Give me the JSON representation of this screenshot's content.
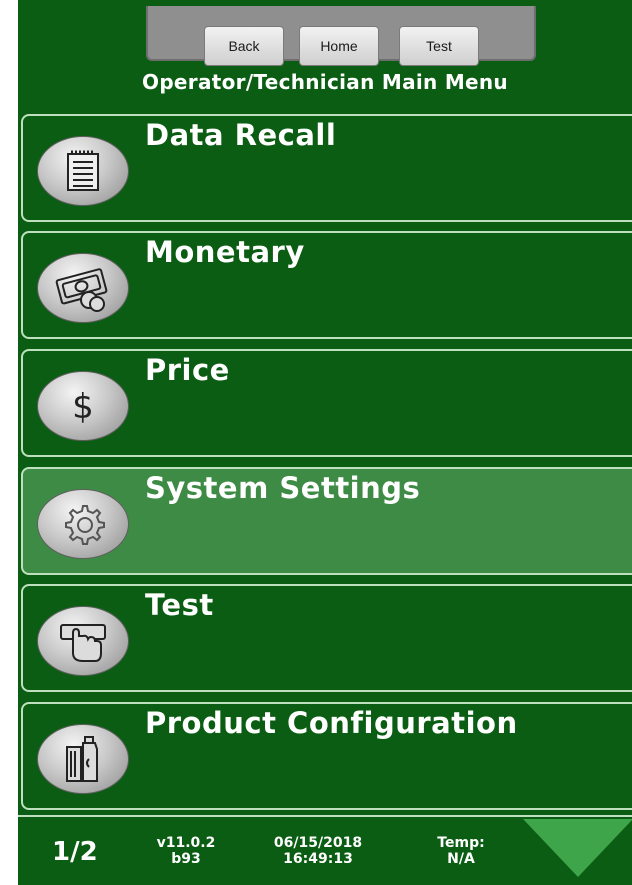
{
  "top_buttons": [
    {
      "label": "Back"
    },
    {
      "label": "Home"
    },
    {
      "label": "Test"
    }
  ],
  "title": "Operator/Technician Main Menu",
  "menu_items": [
    {
      "label": "Data Recall",
      "icon": "notepad-icon"
    },
    {
      "label": "Monetary",
      "icon": "money-icon"
    },
    {
      "label": "Price",
      "icon": "dollar-icon"
    },
    {
      "label": "System Settings",
      "icon": "gear-icon",
      "selected": true
    },
    {
      "label": "Test",
      "icon": "hand-touch-icon"
    },
    {
      "label": "Product Configuration",
      "icon": "product-bottles-icon"
    }
  ],
  "footer": {
    "page": "1/2",
    "version_line1": "v11.0.2",
    "version_line2": "b93",
    "date": "06/15/2018",
    "time": "16:49:13",
    "temp_label": "Temp:",
    "temp_value": "N/A",
    "next_icon": "down-arrow-icon"
  },
  "colors": {
    "background": "#0a5d12",
    "selected": "#3d8b45",
    "text": "#ffffff",
    "arrow": "#3ea54a"
  }
}
